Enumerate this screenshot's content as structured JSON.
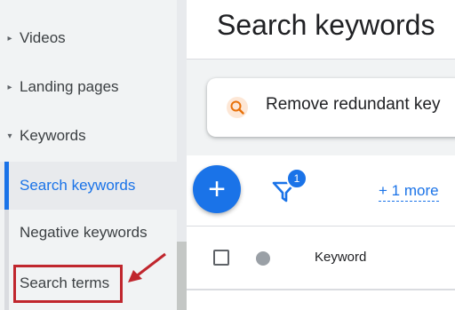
{
  "sidebar": {
    "items": [
      {
        "label": "Videos",
        "caret": "▸"
      },
      {
        "label": "Landing pages",
        "caret": "▸"
      },
      {
        "label": "Keywords",
        "caret": "▾"
      }
    ],
    "subitems": [
      {
        "label": "Search keywords",
        "active": true
      },
      {
        "label": "Negative keywords",
        "active": false
      },
      {
        "label": "Search terms",
        "active": false
      }
    ]
  },
  "main": {
    "title": "Search keywords",
    "recommendation": {
      "icon": "search-icon",
      "text": "Remove redundant key"
    },
    "toolbar": {
      "add_icon": "+",
      "filter_count": "1",
      "more_link": "+ 1 more"
    },
    "table": {
      "columns": [
        "Keyword"
      ]
    }
  },
  "colors": {
    "accent": "#1a73e8",
    "highlight": "#c0262d"
  }
}
